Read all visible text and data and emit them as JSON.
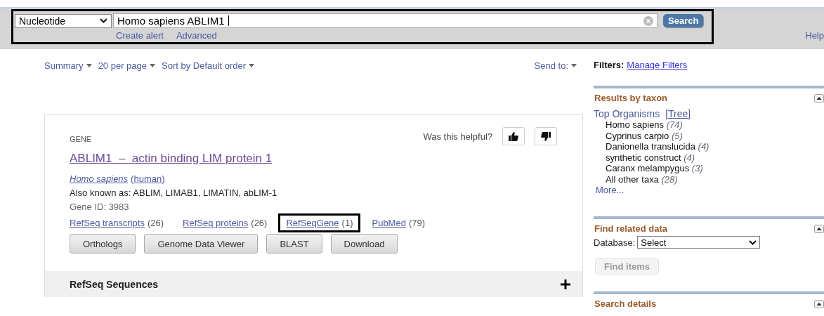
{
  "search": {
    "highlighted": true,
    "database": "Nucleotide",
    "query": "Homo sapiens ABLIM1",
    "button": "Search",
    "links": [
      "Create alert",
      "Advanced"
    ],
    "help": "Help"
  },
  "toolbar": {
    "menus": [
      "Summary",
      "20 per page",
      "Sort by Default order"
    ],
    "send_to": "Send to:"
  },
  "gene_card": {
    "type_label": "GENE",
    "helpful": "Was this helpful?",
    "title": "ABLIM1  –  actin binding LIM protein 1",
    "organism": "Homo sapiens",
    "organism_common": "(human)",
    "aliases": "Also known as: ABLIM, LIMAB1, LIMATIN, abLIM-1",
    "gene_id": "Gene ID: 3983",
    "links": [
      {
        "label": "RefSeq transcripts",
        "count": "(26)",
        "highlighted": false
      },
      {
        "label": "RefSeq proteins",
        "count": "(26)",
        "highlighted": false
      },
      {
        "label": "RefSeqGene",
        "count": "(1)",
        "highlighted": true
      },
      {
        "label": "PubMed",
        "count": "(79)",
        "highlighted": false
      }
    ],
    "buttons": [
      "Orthologs",
      "Genome Data Viewer",
      "BLAST",
      "Download"
    ]
  },
  "section": {
    "title": "RefSeq Sequences",
    "expanded": false
  },
  "filters": {
    "label": "Filters:",
    "link": "Manage Filters"
  },
  "taxon_panel": {
    "title": "Results by taxon",
    "heading": "Top Organisms",
    "tree_link": "[Tree]",
    "organisms": [
      {
        "name": "Homo sapiens",
        "count": "(74)"
      },
      {
        "name": "Cyprinus carpio",
        "count": "(5)"
      },
      {
        "name": "Danionella translucida",
        "count": "(4)"
      },
      {
        "name": "synthetic construct",
        "count": "(4)"
      },
      {
        "name": "Caranx melampygus",
        "count": "(3)"
      },
      {
        "name": "All other taxa",
        "count": "(28)"
      }
    ],
    "more": "More..."
  },
  "related_panel": {
    "title": "Find related data",
    "database_label": "Database:",
    "database_value": "Select",
    "button": "Find items",
    "button_disabled": true
  },
  "details_panel": {
    "title": "Search details"
  }
}
